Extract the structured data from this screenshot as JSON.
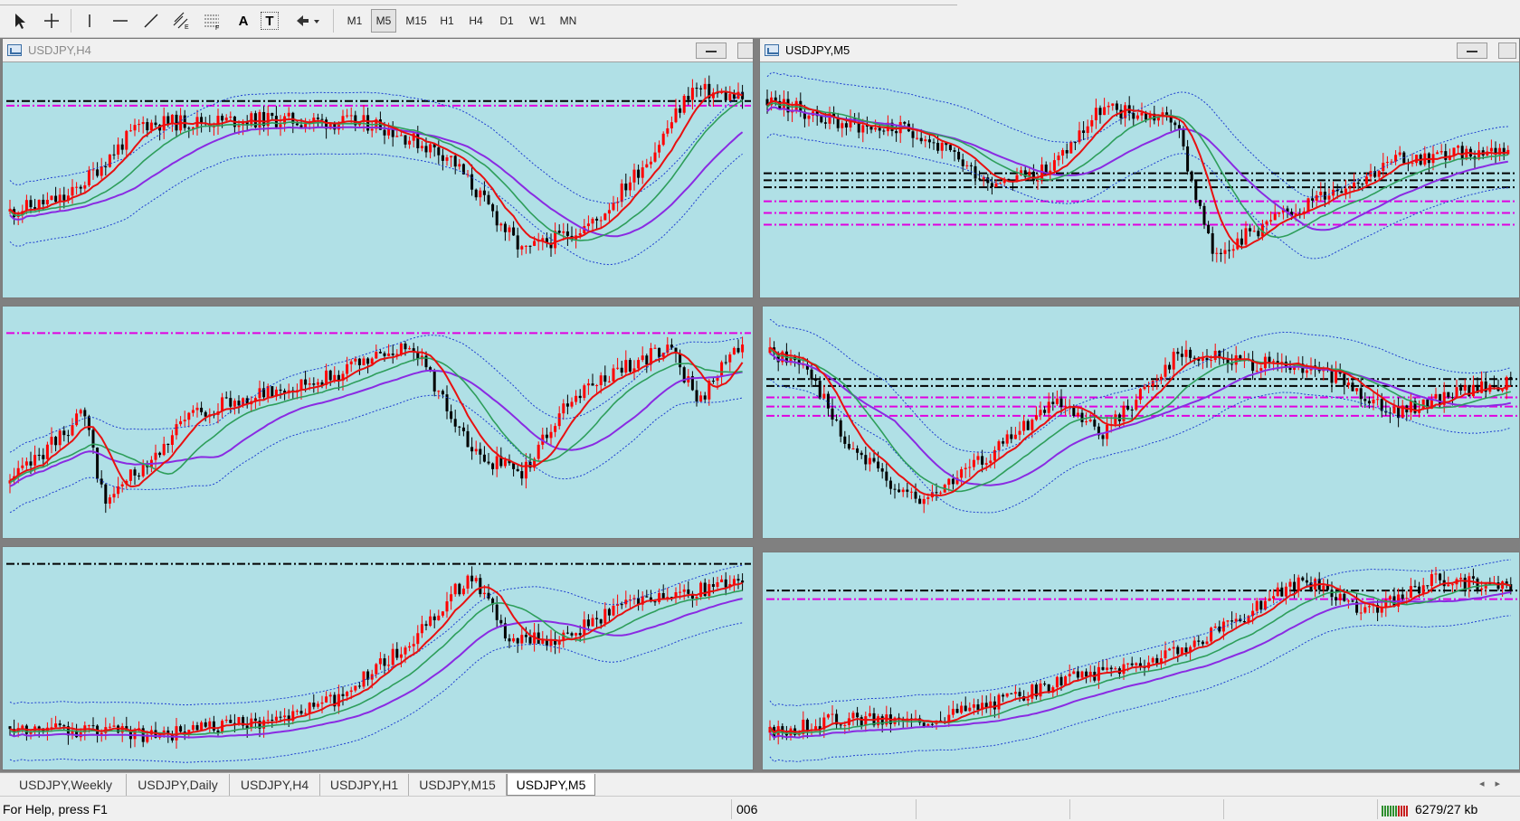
{
  "toolbar": {
    "tools": [
      {
        "name": "cursor-icon"
      },
      {
        "name": "crosshair-icon"
      },
      {
        "name": "vertical-line-icon"
      },
      {
        "name": "horizontal-line-icon"
      },
      {
        "name": "trendline-icon"
      },
      {
        "name": "equidistant-channel-icon"
      },
      {
        "name": "fibonacci-retracement-icon"
      },
      {
        "name": "text-icon",
        "label": "A"
      },
      {
        "name": "text-label-icon",
        "label": "T"
      },
      {
        "name": "arrows-dropdown-icon"
      }
    ],
    "timeframes": [
      "M1",
      "M5",
      "M15",
      "H1",
      "H4",
      "D1",
      "W1",
      "MN"
    ],
    "active_timeframe": "M5"
  },
  "charts": [
    {
      "id": "chart-top-left",
      "title": "USDJPY,H4",
      "title_visible": true,
      "active": false
    },
    {
      "id": "chart-top-right",
      "title": "USDJPY,M5",
      "title_visible": true,
      "active": true
    },
    {
      "id": "chart-middle-left",
      "title": "",
      "title_visible": false
    },
    {
      "id": "chart-middle-right",
      "title": "",
      "title_visible": false
    },
    {
      "id": "chart-bottom-left",
      "title": "",
      "title_visible": false
    },
    {
      "id": "chart-bottom-right",
      "title": "",
      "title_visible": false
    }
  ],
  "chart_style": {
    "background": "#b0e0e6",
    "bull_candle": "#ff0000",
    "bear_candle": "#000000",
    "fast_ma": "#e81010",
    "mid_ma": "#2e9e5b",
    "slow_ma": "#8a2be2",
    "bands": "#1f3fd0",
    "level_black": "#000000",
    "level_magenta": "#e000e0"
  },
  "tabs": [
    "USDJPY,Weekly",
    "USDJPY,Daily",
    "USDJPY,H4",
    "USDJPY,H1",
    "USDJPY,M15",
    "USDJPY,M5"
  ],
  "active_tab": "USDJPY,M5",
  "status": {
    "help": "For Help, press F1",
    "profile": "006",
    "traffic": "6279/27 kb"
  }
}
